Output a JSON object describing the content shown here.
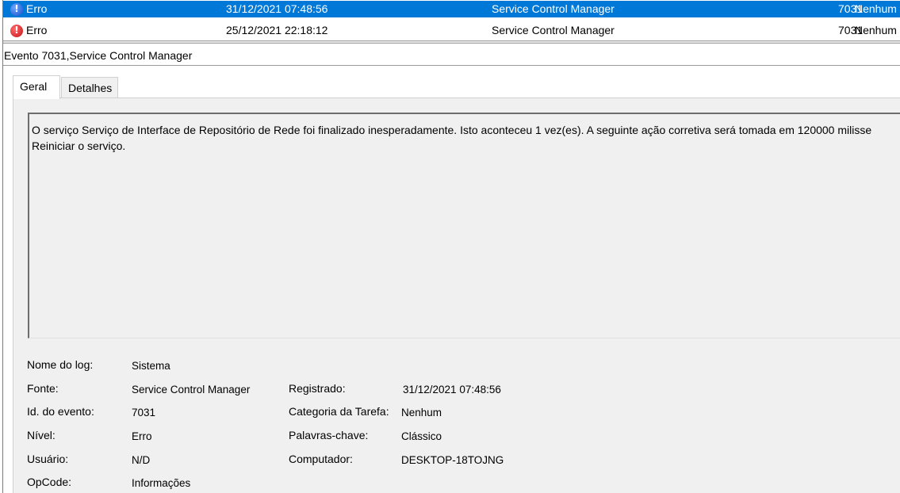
{
  "events": [
    {
      "level": "Erro",
      "date": "31/12/2021 07:48:56",
      "source": "Service Control Manager",
      "id": "7031",
      "category": "Nenhum",
      "selected": true,
      "icon": "info-error-icon"
    },
    {
      "level": "Erro",
      "date": "25/12/2021 22:18:12",
      "source": "Service Control Manager",
      "id": "7031",
      "category": "Nenhum",
      "selected": false,
      "icon": "error-icon"
    }
  ],
  "details": {
    "title": "Evento 7031,Service Control Manager",
    "tabs": [
      "Geral",
      "Detalhes"
    ],
    "message_line_1": "O serviço Serviço de Interface de Repositório de Rede foi finalizado inesperadamente. Isto aconteceu 1 vez(es). A seguinte ação corretiva será tomada em 120000 milisse",
    "message_line_2": "Reiniciar o serviço."
  },
  "properties": {
    "log_name_label": "Nome do log:",
    "log_name_value": "Sistema",
    "source_label": "Fonte:",
    "source_value": "Service Control Manager",
    "logged_label": "Registrado:",
    "logged_value": "31/12/2021 07:48:56",
    "event_id_label": "Id. do evento:",
    "event_id_value": "7031",
    "task_category_label": "Categoria da Tarefa:",
    "task_category_value": "Nenhum",
    "level_label": "Nível:",
    "level_value": "Erro",
    "keywords_label": "Palavras-chave:",
    "keywords_value": "Clássico",
    "user_label": "Usuário:",
    "user_value": "N/D",
    "computer_label": "Computador:",
    "computer_value": "DESKTOP-18TOJNG",
    "opcode_label": "OpCode:",
    "opcode_value": "Informações"
  },
  "colors": {
    "selection": "#0078d7",
    "panel": "#f0f0f0"
  }
}
